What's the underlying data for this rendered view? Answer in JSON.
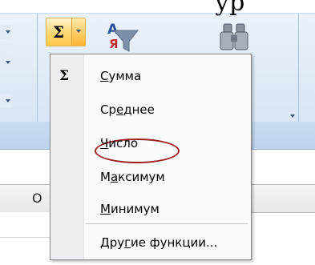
{
  "page": {
    "title_fragment": "ур"
  },
  "ribbon": {
    "autosum_icon": "sigma-icon",
    "autosum_symbol": "Σ",
    "sort_filter_icon": "sort-filter-icon",
    "find_select_icon": "binoculars-icon"
  },
  "menu": {
    "items": [
      {
        "icon": "Σ",
        "pre": "",
        "ul": "С",
        "post": "умма"
      },
      {
        "icon": "",
        "pre": "Ср",
        "ul": "е",
        "post": "днее"
      },
      {
        "icon": "",
        "pre": "",
        "ul": "Ч",
        "post": "исло"
      },
      {
        "icon": "",
        "pre": "М",
        "ul": "а",
        "post": "ксимум"
      },
      {
        "icon": "",
        "pre": "",
        "ul": "М",
        "post": "инимум"
      },
      {
        "icon": "",
        "pre": "Дру",
        "ul": "г",
        "post": "ие функции..."
      }
    ],
    "highlighted_item": "Среднее",
    "highlight_color": "#a02020"
  },
  "sheet": {
    "column_letter": "O"
  }
}
